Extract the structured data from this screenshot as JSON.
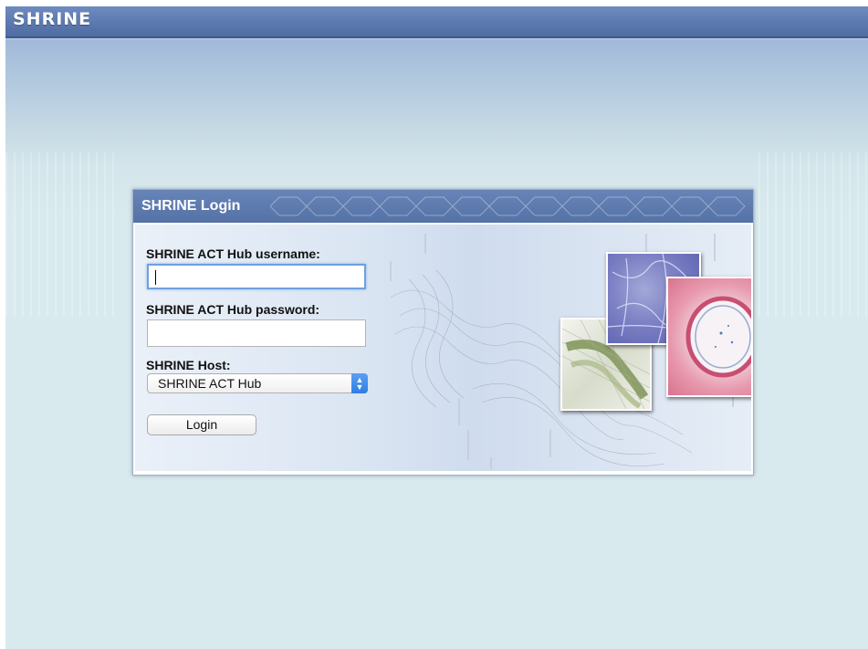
{
  "app": {
    "title": "SHRINE"
  },
  "login_panel": {
    "title": "SHRINE Login",
    "username": {
      "label": "SHRINE ACT Hub username:",
      "value": ""
    },
    "password": {
      "label": "SHRINE ACT Hub password:",
      "value": ""
    },
    "host": {
      "label": "SHRINE Host:",
      "selected": "SHRINE ACT Hub"
    },
    "login_button": "Login"
  },
  "colors": {
    "brand_header": "#5a78ad",
    "page_background": "#d8eaee",
    "focus_ring": "#6fa0de",
    "select_accent": "#2f7ee6"
  },
  "icons": {
    "select_arrows": "chevron-up-down-icon"
  }
}
